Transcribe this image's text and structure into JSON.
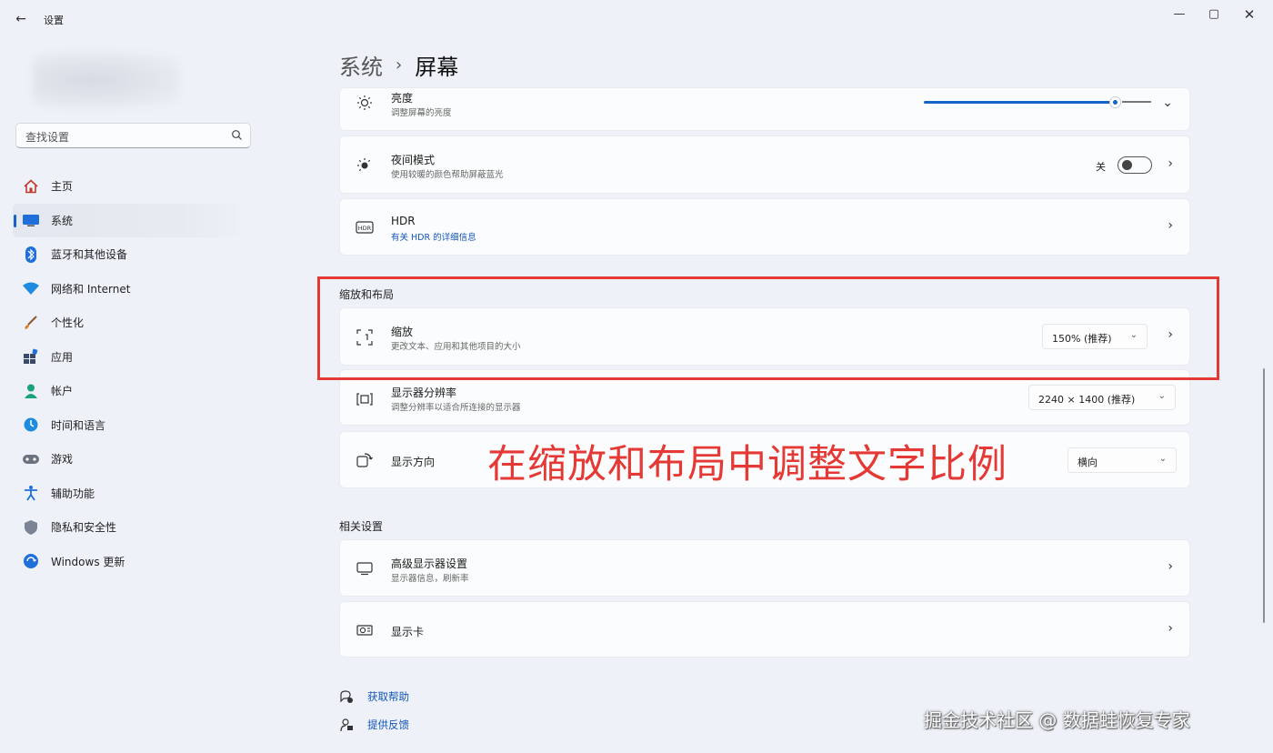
{
  "window": {
    "app_title": "设置",
    "back_icon": "back-arrow-icon",
    "controls": {
      "minimize": "—",
      "maximize": "▢",
      "close": "✕"
    }
  },
  "search": {
    "placeholder": "查找设置"
  },
  "sidebar": {
    "items": [
      {
        "label": "主页",
        "icon": "home-icon"
      },
      {
        "label": "系统",
        "icon": "system-icon",
        "active": true
      },
      {
        "label": "蓝牙和其他设备",
        "icon": "bluetooth-icon"
      },
      {
        "label": "网络和 Internet",
        "icon": "network-icon"
      },
      {
        "label": "个性化",
        "icon": "personalization-icon"
      },
      {
        "label": "应用",
        "icon": "apps-icon"
      },
      {
        "label": "帐户",
        "icon": "account-icon"
      },
      {
        "label": "时间和语言",
        "icon": "time-language-icon"
      },
      {
        "label": "游戏",
        "icon": "gaming-icon"
      },
      {
        "label": "辅助功能",
        "icon": "accessibility-icon"
      },
      {
        "label": "隐私和安全性",
        "icon": "privacy-icon"
      },
      {
        "label": "Windows 更新",
        "icon": "windows-update-icon"
      }
    ]
  },
  "breadcrumb": {
    "parent": "系统",
    "separator": "›",
    "current": "屏幕"
  },
  "rows": {
    "brightness": {
      "title": "亮度",
      "subtitle": "调整屏幕的亮度",
      "value": 0.86
    },
    "night_light": {
      "title": "夜间模式",
      "subtitle": "使用较暖的颜色帮助屏蔽蓝光",
      "state": "关"
    },
    "hdr": {
      "title": "HDR",
      "subtitle": "有关 HDR 的详细信息"
    },
    "scale": {
      "title": "缩放",
      "subtitle": "更改文本、应用和其他项目的大小",
      "value": "150% (推荐)"
    },
    "resolution": {
      "title": "显示器分辨率",
      "subtitle": "调整分辨率以适合所连接的显示器",
      "value": "2240 × 1400 (推荐)"
    },
    "orientation": {
      "title": "显示方向",
      "value": "横向"
    },
    "advanced_display": {
      "title": "高级显示器设置",
      "subtitle": "显示器信息，刷新率"
    },
    "graphics": {
      "title": "显示卡"
    }
  },
  "sections": {
    "scale_layout": "缩放和布局",
    "related": "相关设置"
  },
  "annotation": "在缩放和布局中调整文字比例",
  "footer": {
    "help": "获取帮助",
    "feedback": "提供反馈"
  },
  "watermark": "掘金技术社区 @ 数据蛙恢复专家",
  "colors": {
    "accent": "#1463c7",
    "highlight": "#e53935",
    "background": "#eef2f8"
  }
}
